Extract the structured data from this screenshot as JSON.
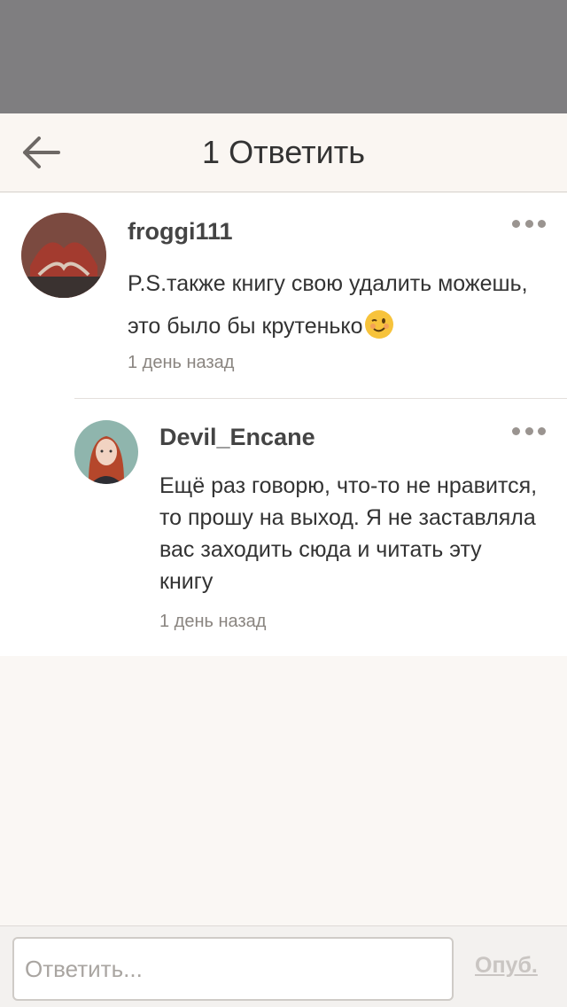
{
  "header": {
    "title": "1 Ответить"
  },
  "comments": [
    {
      "author": "froggi111",
      "text": "P.S.также книгу свою удалить можешь, это было бы крутенько",
      "emoji": "winking-face",
      "time": "1 день назад"
    },
    {
      "author": "Devil_Encane",
      "text": "Ещё раз говорю, что-то не нравится, то прошу на выход. Я не заставляла вас заходить сюда и читать эту книгу",
      "time": "1 день назад"
    }
  ],
  "footer": {
    "placeholder": "Ответить...",
    "publish_label": "Опуб."
  },
  "colors": {
    "top_bar": "#7f7e80",
    "header_bg": "#faf6f2",
    "emoji": "#f7c33b"
  }
}
